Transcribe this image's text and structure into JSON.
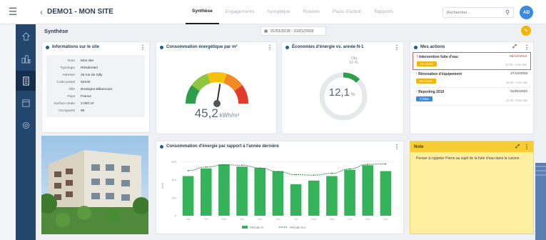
{
  "header": {
    "site_title": "DEMO1 - MON SITE",
    "tabs": [
      {
        "label": "Synthèse",
        "active": true
      },
      {
        "label": "Engagements",
        "active": false
      },
      {
        "label": "Synoptique",
        "active": false
      },
      {
        "label": "Relevés",
        "active": false
      },
      {
        "label": "Plans d'action",
        "active": false
      },
      {
        "label": "Rapports",
        "active": false
      }
    ],
    "search_placeholder": "Rechercher...",
    "avatar_initials": "AD"
  },
  "sidebar": {
    "items": [
      {
        "icon": "building-tree-icon"
      },
      {
        "icon": "city-icon"
      },
      {
        "icon": "building-icon",
        "active": true
      },
      {
        "icon": "calendar-icon"
      },
      {
        "icon": "settings-icon"
      }
    ]
  },
  "page": {
    "title": "Synthèse",
    "date_range": "01/01/2018 - 31/01/2018"
  },
  "info_card": {
    "title": "Informations sur le site",
    "rows": [
      {
        "k": "Nom",
        "v": "Mon site"
      },
      {
        "k": "Typologie",
        "v": "Résidentiel"
      },
      {
        "k": "Adresse",
        "v": "25 rue de Silly"
      },
      {
        "k": "Code postal",
        "v": "92100"
      },
      {
        "k": "Ville",
        "v": "Boulogne-Billancourt"
      },
      {
        "k": "Pays",
        "v": "France"
      },
      {
        "k": "Surface totale",
        "v": "3 000 m²"
      },
      {
        "k": "Occupants",
        "v": "85"
      }
    ]
  },
  "gauge_card": {
    "title": "Consommation énergétique par m²",
    "value": "45,2",
    "unit": "kWh/m²",
    "level": 0.55,
    "colors": [
      "#2e9e4a",
      "#8dc63f",
      "#f4c20d",
      "#f08a24",
      "#e23b2e"
    ]
  },
  "savings_card": {
    "title": "Économies d'énergie vs. année N-1",
    "value": "12,1",
    "unit": "%",
    "objective_label": "Obj.",
    "objective_value": "10 %",
    "fraction": 0.121,
    "color": "#2e9e4a"
  },
  "actions_card": {
    "title": "Mes actions",
    "items": [
      {
        "title": "Intervention fuite d'eau",
        "date": "05/10/2018",
        "status": "En cours",
        "status_color": "#f3b500",
        "meta": "10:40 - mon site",
        "urgent": true
      },
      {
        "title": "Rénovation d'équipement",
        "date": "17/12/2018",
        "status": "En cours",
        "status_color": "#f3b500",
        "meta": "10:40 - mon site",
        "urgent": false
      },
      {
        "title": "Reporting 2019",
        "date": "01/01/2020",
        "status": "À faire",
        "status_color": "#3a8be0",
        "meta": "10:40 - mon site",
        "urgent": false
      }
    ]
  },
  "chart_card": {
    "title": "Consommation d'énergie par rapport à l'année dernière",
    "ylabel": "kWh",
    "legend_bar": "Période N",
    "legend_line": "Période N-1"
  },
  "chart_data": {
    "type": "bar",
    "categories": [
      "Jan",
      "Fév",
      "Mar",
      "Avr",
      "Mai",
      "Juin",
      "Juil",
      "Août",
      "Sept",
      "Oct",
      "Nov",
      "Déc"
    ],
    "series": [
      {
        "name": "Période N",
        "type": "bar",
        "color": "#34b35a",
        "values": [
          440,
          525,
          570,
          545,
          530,
          495,
          350,
          390,
          440,
          510,
          560,
          495
        ]
      },
      {
        "name": "Période N-1",
        "type": "line",
        "color": "#2f7a4a",
        "values": [
          500,
          540,
          565,
          560,
          530,
          490,
          455,
          450,
          470,
          520,
          570,
          575
        ]
      }
    ],
    "ylabel": "kWh",
    "yticks": [
      0,
      200,
      400,
      600
    ],
    "ylim": [
      0,
      650
    ],
    "grid": true,
    "legend": "bottom"
  },
  "note_card": {
    "title": "Note",
    "text": "Penser à rappeler Pierre au sujet de la fuite d'eau dans la cuisine."
  }
}
